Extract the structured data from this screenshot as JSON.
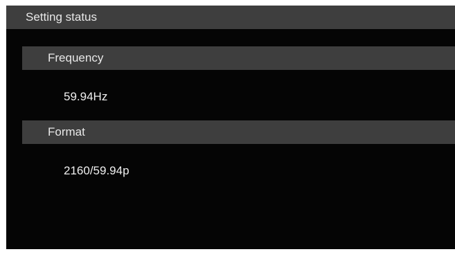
{
  "header": {
    "title": "Setting status"
  },
  "sections": [
    {
      "label": "Frequency",
      "value": "59.94Hz"
    },
    {
      "label": "Format",
      "value": "2160/59.94p"
    }
  ]
}
